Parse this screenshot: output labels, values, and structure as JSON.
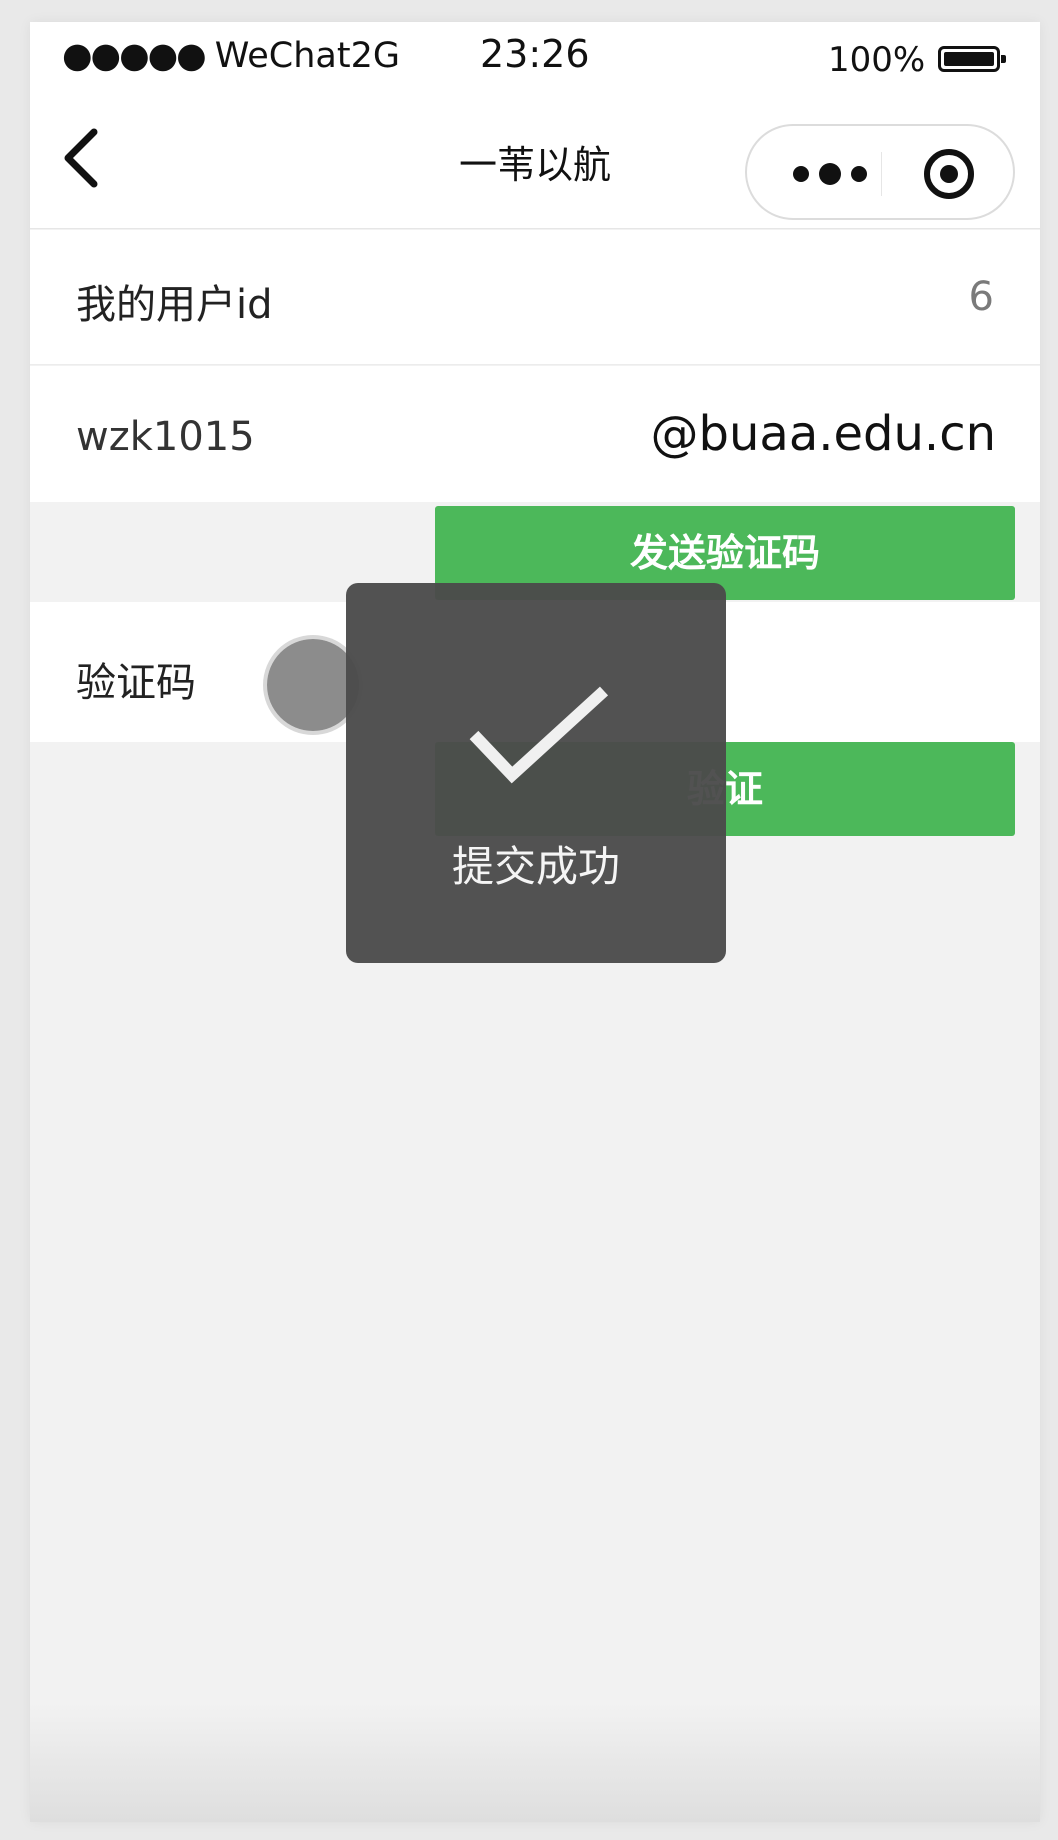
{
  "status_bar": {
    "signal_dots": "●●●●●",
    "carrier": "WeChat2G",
    "time": "23:26",
    "battery_percent": "100%",
    "battery_level": 1.0
  },
  "nav": {
    "title": "一苇以航",
    "back_icon": "chevron-left-icon",
    "more_icon": "more-dots-icon",
    "home_icon": "target-icon"
  },
  "form": {
    "user_id_label": "我的用户id",
    "user_id_value": "6",
    "email_prefix": "wzk1015",
    "email_domain": "@buaa.edu.cn",
    "send_code_button": "发送验证码",
    "code_label": "验证码",
    "verify_button": "验证"
  },
  "toast": {
    "icon": "checkmark-icon",
    "message": "提交成功"
  },
  "colors": {
    "accent_green": "#4cb85a",
    "toast_background": "#4b4b4b",
    "page_background": "#f2f2f2"
  }
}
